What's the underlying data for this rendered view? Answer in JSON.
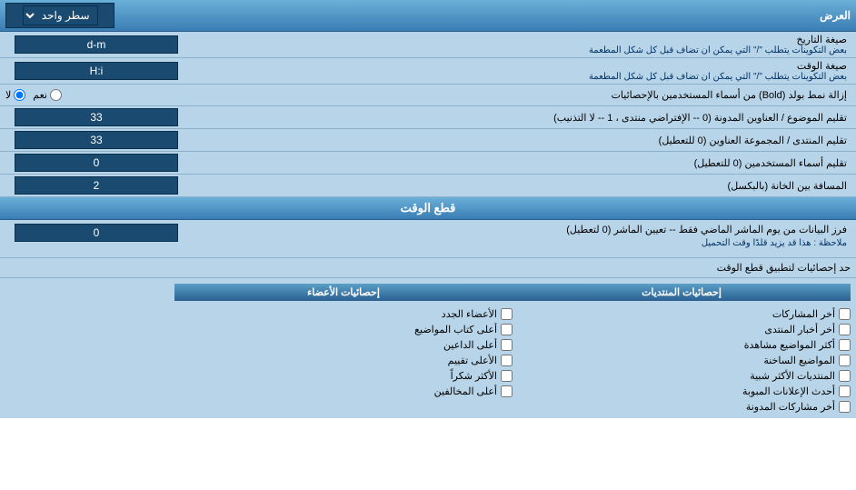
{
  "page": {
    "title": "العرض",
    "rows": {
      "display_mode_label": "العرض",
      "display_mode_value": "سطر واحد",
      "date_format_label": "صيغة التاريخ",
      "date_format_desc": "بعض التكوينات يتطلب \"/\" التي يمكن ان تضاف قبل كل شكل المطعمة",
      "date_format_value": "d-m",
      "time_format_label": "صيغة الوقت",
      "time_format_desc": "بعض التكوينات يتطلب \"/\" التي يمكن ان تضاف قبل كل شكل المطعمة",
      "time_format_value": "H:i",
      "bold_label": "إزالة نمط بولد (Bold) من أسماء المستخدمين بالإحصائيات",
      "bold_yes": "نعم",
      "bold_no": "لا",
      "sort_posts_label": "تقليم الموضوع / العناوين المدونة (0 -- الإفتراضي منتدى ، 1 -- لا التذنيب)",
      "sort_posts_value": "33",
      "sort_forum_label": "تقليم المنتدى / المجموعة العناوين (0 للتعطيل)",
      "sort_forum_value": "33",
      "sort_users_label": "تقليم أسماء المستخدمين (0 للتعطيل)",
      "sort_users_value": "0",
      "spacing_label": "المسافة بين الخانة (بالبكسل)",
      "spacing_value": "2",
      "cutoff_title": "قطع الوقت",
      "cutoff_label": "فرز البيانات من يوم الماشر الماضي فقط -- تعيين الماشر (0 لتعطيل)",
      "cutoff_note": "ملاحظة : هذا قد يزيد قلدًا وقت التحميل",
      "cutoff_value": "0",
      "stats_limit_label": "حد إحصائيات لتطبيق قطع الوقت",
      "stats_posts_header": "إحصائيات المنتديات",
      "stats_members_header": "إحصائيات الأعضاء",
      "stats_posts_items": [
        "أخر المشاركات",
        "أخر أخبار المنتدى",
        "أكثر المواضيع مشاهدة",
        "المواضيع الساخنة",
        "المنتديات الأكثر شبية",
        "أحدث الإعلانات المبوبة",
        "أخر مشاركات المدونة"
      ],
      "stats_members_items": [
        "الأعضاء الجدد",
        "أعلى كتاب المواضيع",
        "أعلى الداعين",
        "الأعلى تقييم",
        "الأكثر شكراً",
        "أعلى المخالفين"
      ]
    }
  }
}
